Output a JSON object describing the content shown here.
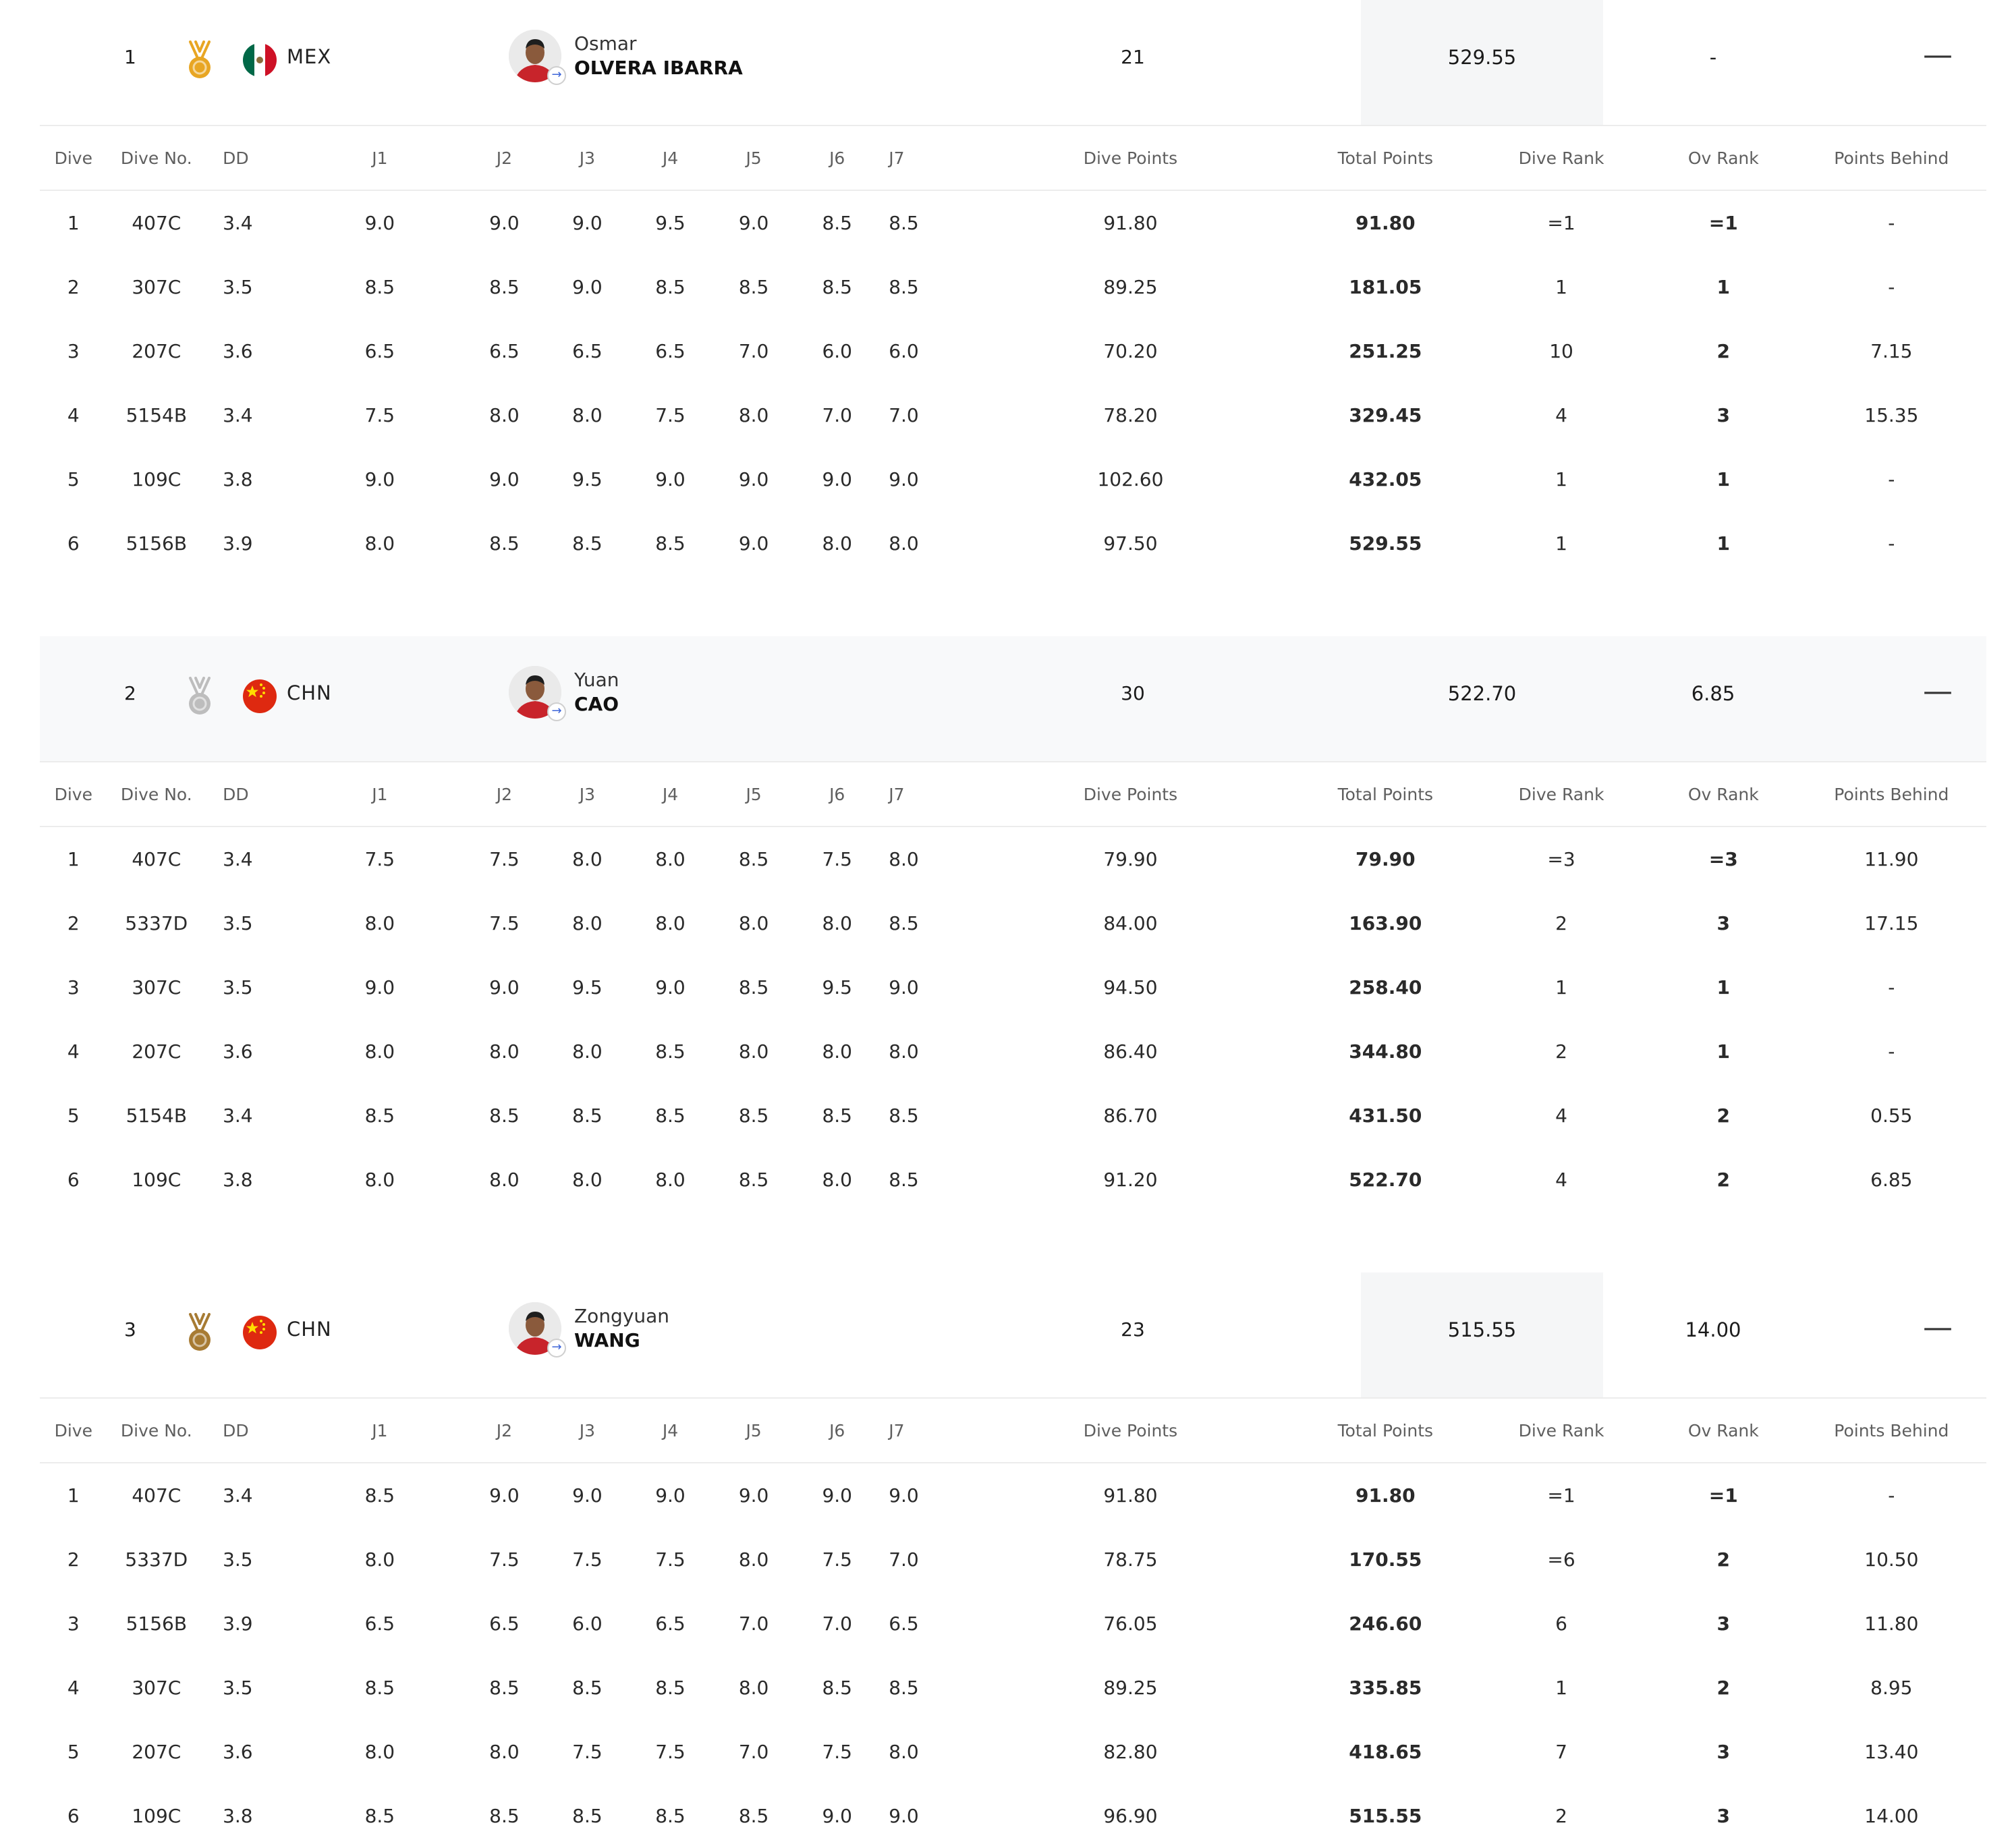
{
  "columns": [
    "Dive",
    "Dive No.",
    "DD",
    "J1",
    "J2",
    "J3",
    "J4",
    "J5",
    "J6",
    "J7",
    "Dive Points",
    "Total Points",
    "Dive Rank",
    "Ov Rank",
    "Points Behind"
  ],
  "athletes": [
    {
      "rank": "1",
      "medal": "gold",
      "medal_color": "#e8a623",
      "noc": "MEX",
      "flag_icon": "mexico-flag-icon",
      "first_name": "Osmar",
      "last_name": "OLVERA IBARRA",
      "age": "21",
      "total": "529.55",
      "behind": "-",
      "collapse_symbol": "—",
      "dives": [
        [
          "1",
          "407C",
          "3.4",
          "9.0",
          "9.0",
          "9.0",
          "9.5",
          "9.0",
          "8.5",
          "8.5",
          "91.80",
          "91.80",
          "=1",
          "=1",
          "-"
        ],
        [
          "2",
          "307C",
          "3.5",
          "8.5",
          "8.5",
          "9.0",
          "8.5",
          "8.5",
          "8.5",
          "8.5",
          "89.25",
          "181.05",
          "1",
          "1",
          "-"
        ],
        [
          "3",
          "207C",
          "3.6",
          "6.5",
          "6.5",
          "6.5",
          "6.5",
          "7.0",
          "6.0",
          "6.0",
          "70.20",
          "251.25",
          "10",
          "2",
          "7.15"
        ],
        [
          "4",
          "5154B",
          "3.4",
          "7.5",
          "8.0",
          "8.0",
          "7.5",
          "8.0",
          "7.0",
          "7.0",
          "78.20",
          "329.45",
          "4",
          "3",
          "15.35"
        ],
        [
          "5",
          "109C",
          "3.8",
          "9.0",
          "9.0",
          "9.5",
          "9.0",
          "9.0",
          "9.0",
          "9.0",
          "102.60",
          "432.05",
          "1",
          "1",
          "-"
        ],
        [
          "6",
          "5156B",
          "3.9",
          "8.0",
          "8.5",
          "8.5",
          "8.5",
          "9.0",
          "8.0",
          "8.0",
          "97.50",
          "529.55",
          "1",
          "1",
          "-"
        ]
      ]
    },
    {
      "rank": "2",
      "medal": "silver",
      "medal_color": "#bdbdbd",
      "noc": "CHN",
      "flag_icon": "china-flag-icon",
      "first_name": "Yuan",
      "last_name": "CAO",
      "age": "30",
      "total": "522.70",
      "behind": "6.85",
      "collapse_symbol": "—",
      "dives": [
        [
          "1",
          "407C",
          "3.4",
          "7.5",
          "7.5",
          "8.0",
          "8.0",
          "8.5",
          "7.5",
          "8.0",
          "79.90",
          "79.90",
          "=3",
          "=3",
          "11.90"
        ],
        [
          "2",
          "5337D",
          "3.5",
          "8.0",
          "7.5",
          "8.0",
          "8.0",
          "8.0",
          "8.0",
          "8.5",
          "84.00",
          "163.90",
          "2",
          "3",
          "17.15"
        ],
        [
          "3",
          "307C",
          "3.5",
          "9.0",
          "9.0",
          "9.5",
          "9.0",
          "8.5",
          "9.5",
          "9.0",
          "94.50",
          "258.40",
          "1",
          "1",
          "-"
        ],
        [
          "4",
          "207C",
          "3.6",
          "8.0",
          "8.0",
          "8.0",
          "8.5",
          "8.0",
          "8.0",
          "8.0",
          "86.40",
          "344.80",
          "2",
          "1",
          "-"
        ],
        [
          "5",
          "5154B",
          "3.4",
          "8.5",
          "8.5",
          "8.5",
          "8.5",
          "8.5",
          "8.5",
          "8.5",
          "86.70",
          "431.50",
          "4",
          "2",
          "0.55"
        ],
        [
          "6",
          "109C",
          "3.8",
          "8.0",
          "8.0",
          "8.0",
          "8.0",
          "8.5",
          "8.0",
          "8.5",
          "91.20",
          "522.70",
          "4",
          "2",
          "6.85"
        ]
      ]
    },
    {
      "rank": "3",
      "medal": "bronze",
      "medal_color": "#a77b33",
      "noc": "CHN",
      "flag_icon": "china-flag-icon",
      "first_name": "Zongyuan",
      "last_name": "WANG",
      "age": "23",
      "total": "515.55",
      "behind": "14.00",
      "collapse_symbol": "—",
      "dives": [
        [
          "1",
          "407C",
          "3.4",
          "8.5",
          "9.0",
          "9.0",
          "9.0",
          "9.0",
          "9.0",
          "9.0",
          "91.80",
          "91.80",
          "=1",
          "=1",
          "-"
        ],
        [
          "2",
          "5337D",
          "3.5",
          "8.0",
          "7.5",
          "7.5",
          "7.5",
          "8.0",
          "7.5",
          "7.0",
          "78.75",
          "170.55",
          "=6",
          "2",
          "10.50"
        ],
        [
          "3",
          "5156B",
          "3.9",
          "6.5",
          "6.5",
          "6.0",
          "6.5",
          "7.0",
          "7.0",
          "6.5",
          "76.05",
          "246.60",
          "6",
          "3",
          "11.80"
        ],
        [
          "4",
          "307C",
          "3.5",
          "8.5",
          "8.5",
          "8.5",
          "8.5",
          "8.0",
          "8.5",
          "8.5",
          "89.25",
          "335.85",
          "1",
          "2",
          "8.95"
        ],
        [
          "5",
          "207C",
          "3.6",
          "8.0",
          "8.0",
          "7.5",
          "7.5",
          "7.0",
          "7.5",
          "8.0",
          "82.80",
          "418.65",
          "7",
          "3",
          "13.40"
        ],
        [
          "6",
          "109C",
          "3.8",
          "8.5",
          "8.5",
          "8.5",
          "8.5",
          "8.5",
          "9.0",
          "9.0",
          "96.90",
          "515.55",
          "2",
          "3",
          "14.00"
        ]
      ]
    }
  ]
}
